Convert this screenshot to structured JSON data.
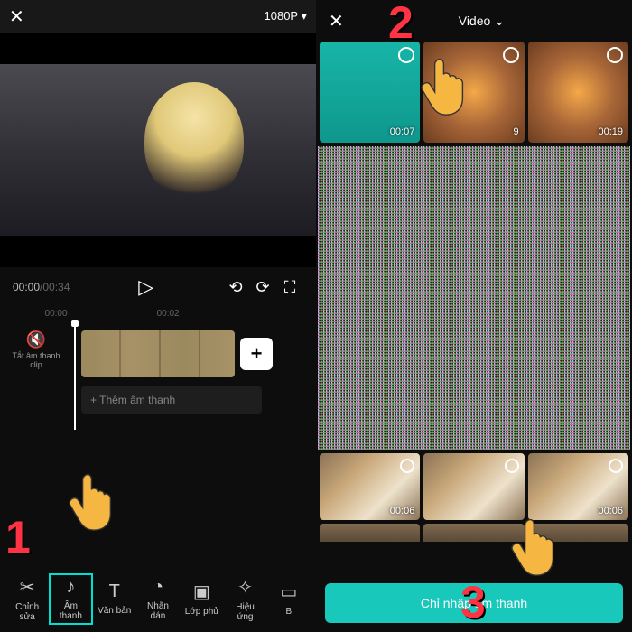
{
  "left": {
    "close": "✕",
    "resolution": "1080P ▾",
    "time_cur": "00:00",
    "time_dur": "/00:34",
    "ruler": [
      "00:00",
      "00:02"
    ],
    "mute_label": "Tắt âm thanh clip",
    "add_audio": "+  Thêm âm thanh",
    "tools": [
      {
        "icon": "✂",
        "label": "Chỉnh sửa"
      },
      {
        "icon": "♪",
        "label": "Âm thanh"
      },
      {
        "icon": "T",
        "label": "Văn bản"
      },
      {
        "icon": "◔",
        "label": "Nhãn dán"
      },
      {
        "icon": "▣",
        "label": "Lớp phủ"
      },
      {
        "icon": "✧",
        "label": "Hiệu ứng"
      },
      {
        "icon": "▭",
        "label": "B"
      }
    ],
    "selected_tool": 1
  },
  "right": {
    "close": "✕",
    "dropdown": "Video",
    "thumbs": [
      {
        "dur": "00:07"
      },
      {
        "dur": "9"
      },
      {
        "dur": "00:19"
      }
    ],
    "bthumbs": [
      {
        "dur": "00:06"
      },
      {
        "dur": ""
      },
      {
        "dur": "00:06"
      }
    ],
    "import_btn": "Chỉ nhập âm thanh"
  },
  "annotations": {
    "n1": "1",
    "n2": "2",
    "n3": "3"
  }
}
